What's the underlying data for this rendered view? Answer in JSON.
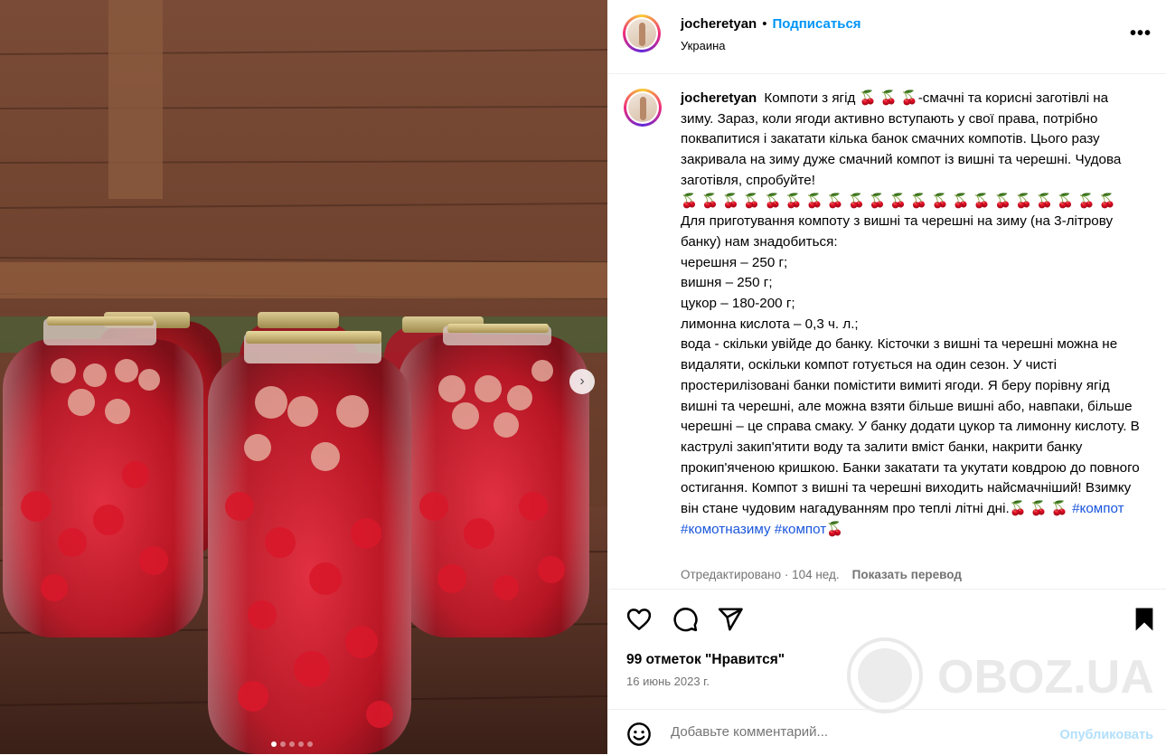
{
  "post": {
    "username": "jocheretyan",
    "bullet": "•",
    "follow_label": "Подписаться",
    "location": "Украина",
    "more_label": "•••"
  },
  "caption": {
    "username": "jocheretyan",
    "cherry": "🍒",
    "part1": " Компоти з ягід ",
    "cherries3": "🍒 🍒 🍒",
    "part2": "-смачні та корисні заготівлі на зиму. Зараз, коли ягоди активно вступають у свої права, потрібно поквапитися і закатати кілька банок смачних компотів. Цього разу закривала на зиму дуже смачний компот із вишні та черешні. Чудова заготівля, спробуйте!\n",
    "cherries21": "🍒 🍒 🍒 🍒 🍒 🍒 🍒 🍒 🍒 🍒 🍒 🍒 🍒 🍒 🍒 🍒 🍒 🍒 🍒 🍒 🍒",
    "body": "\nДля приготування компоту з вишні та черешні на зиму (на 3-літрову банку) нам знадобиться:\nчерешня – 250 г;\nвишня – 250 г;\nцукор – 180-200 г;\nлимонна кислота – 0,3 ч. л.;\nвода - скільки увійде до банку. Кісточки з вишні та черешні можна не видаляти, оскільки компот готується на один сезон. У чисті простерилізовані банки помістити вимиті ягоди. Я беру порівну ягід вишні та черешні, але можна взяти більше вишні або, навпаки, більше черешні – це справа смаку. У банку додати цукор та лимонну кислоту. В каструлі закип'ятити воду та залити вміст банки, накрити банку прокип'яченою кришкою. Банки закатати та укутати ковдрою до повного остигання. Компот з вишні та черешні виходить найсмачніший! Взимку він стане чудовим нагадуванням про теплі літні дні.",
    "cherries_end": "🍒 🍒 🍒",
    "tags": [
      "#компот",
      "#комотназиму",
      "#компот"
    ],
    "final_cherry": "🍒"
  },
  "meta": {
    "edited": "Отредактировано · 104 нед.",
    "translate": "Показать перевод"
  },
  "stats": {
    "likes": "99 отметок \"Нравится\"",
    "date": "16 июнь 2023 г."
  },
  "comment": {
    "placeholder": "Добавьте комментарий...",
    "publish": "Опубликовать"
  },
  "carousel": {
    "next_label": "›",
    "slides": 5,
    "active": 0
  },
  "watermark": {
    "text": "OBOZ.UA"
  },
  "colors": {
    "link_blue": "#0095f6",
    "hashtag": "#1a56db",
    "muted": "#737373",
    "publish_disabled": "#b2dffc"
  },
  "icons": [
    "heart-icon",
    "comment-icon",
    "share-icon",
    "bookmark-icon",
    "emoji-icon",
    "more-icon",
    "chevron-right-icon"
  ]
}
